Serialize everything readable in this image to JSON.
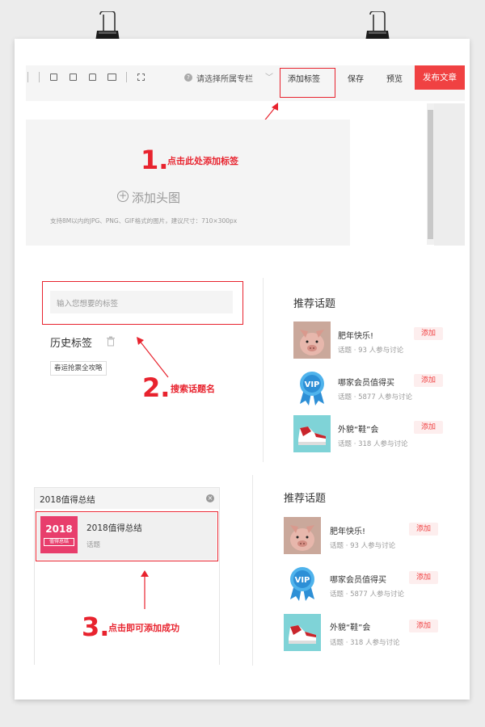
{
  "toolbar": {
    "column_select": "请选择所属专栏",
    "add_tag": "添加标签",
    "save": "保存",
    "preview": "预览",
    "publish": "发布文章"
  },
  "steps": [
    {
      "number": "1.",
      "text": "点击此处添加标签"
    },
    {
      "number": "2.",
      "text": "搜索话题名"
    },
    {
      "number": "3.",
      "text": "点击即可添加成功"
    }
  ],
  "header_image": {
    "title": "添加头图",
    "hint": "支持8M以内的JPG、PNG、GIF格式的图片，建议尺寸：710×300px"
  },
  "tag_input": {
    "placeholder": "输入您想要的标签"
  },
  "history": {
    "title": "历史标签",
    "items": [
      "春运抢票全攻略"
    ]
  },
  "recommend": {
    "title": "推荐话题",
    "add_label": "添加",
    "topics": [
      {
        "name": "肥年快乐!",
        "meta": "话题 · 93 人参与讨论",
        "icon": "pig-photo"
      },
      {
        "name": "哪家会员值得买",
        "meta": "话题 · 5877 人参与讨论",
        "icon": "vip-badge-icon"
      },
      {
        "name": "外貌“鞋”会",
        "meta": "话题 · 318 人参与讨论",
        "icon": "sneaker-photo"
      }
    ]
  },
  "search": {
    "query": "2018值得总结",
    "result": {
      "badge_year": "2018",
      "badge_sub": "值得总结",
      "title": "2018值得总结",
      "type": "话题"
    }
  },
  "colors": {
    "accent": "#f04142",
    "annotation": "#e8232e",
    "badge": "#e83e6c"
  }
}
